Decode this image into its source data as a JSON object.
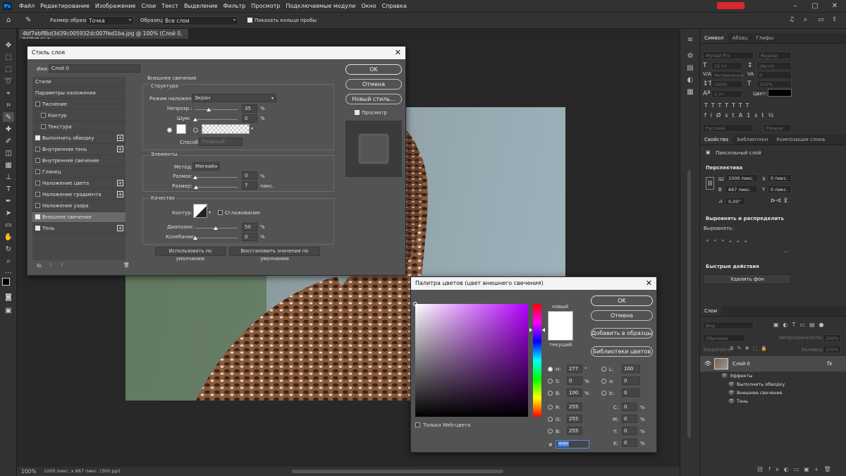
{
  "menu": [
    "Файл",
    "Редактирование",
    "Изображение",
    "Слои",
    "Текст",
    "Выделение",
    "Фильтр",
    "Просмотр",
    "Подключаемые модули",
    "Окно",
    "Справка"
  ],
  "options": {
    "sample_size_label": "Размер образца:",
    "sample_size": "Точка",
    "sample_label": "Образец:",
    "sample": "Все слои",
    "show_ring": "Показать кольцо пробы"
  },
  "document": {
    "tab": "4bf7ebf8bd3d39c005932dc007fed1ba.jpg @ 100% (Слой 0, RGB/8#) *",
    "zoom": "100%",
    "info": "1000 пикс. x 667 пикс. (300 ppi)"
  },
  "right": {
    "tabs_char": [
      "Символ",
      "Абзац",
      "Глифы"
    ],
    "font": "Myriad Pro",
    "style": "Regular",
    "size": "12 пт",
    "leading": "(Авто)",
    "kerning": "Метрически",
    "tracking": "0",
    "vscale": "100%",
    "hscale": "100%",
    "baseline": "0 пт",
    "color_label": "Цвет:",
    "lang": "Русский",
    "aa": "Резкое",
    "tabs_props": [
      "Свойства",
      "Библиотеки",
      "Композиции слоев"
    ],
    "pixel_layer": "Пиксельный слой",
    "perspective": "Перспектива",
    "w_label": "Ш",
    "w": "1000 пикс.",
    "h_label": "В",
    "h": "667 пикс.",
    "x_label": "X",
    "x": "0 пикс.",
    "y_label": "Y",
    "y": "0 пикс.",
    "angle": "0,00°",
    "align_title": "Выровнять и распределить",
    "align_label": "Выровнять:",
    "quick_title": "Быстрые действия",
    "remove_bg": "Удалить фон",
    "layers_tab": "Слои",
    "kind": "Вид",
    "blend": "Обычные",
    "opacity_label": "Непрозрачность:",
    "opacity": "100%",
    "lock_label": "Закрепить:",
    "fill_label": "Заливка:",
    "fill": "100%",
    "layer_name": "Слой 0",
    "effects": "Эффекты",
    "fx1": "Выполнить обводку",
    "fx2": "Внешнее свечение",
    "fx3": "Тень"
  },
  "style_dialog": {
    "title": "Стиль слоя",
    "name_label": "Имя:",
    "name": "Слой 0",
    "items": [
      {
        "label": "Стили",
        "check": null,
        "plus": false,
        "indent": false
      },
      {
        "label": "Параметры наложения",
        "check": null,
        "plus": false,
        "indent": false
      },
      {
        "label": "Тиснение",
        "check": false,
        "plus": false,
        "indent": false
      },
      {
        "label": "Контур",
        "check": false,
        "plus": false,
        "indent": true
      },
      {
        "label": "Текстура",
        "check": false,
        "plus": false,
        "indent": true
      },
      {
        "label": "Выполнить обводку",
        "check": true,
        "plus": true,
        "indent": false
      },
      {
        "label": "Внутренняя тень",
        "check": false,
        "plus": true,
        "indent": false
      },
      {
        "label": "Внутреннее свечение",
        "check": false,
        "plus": false,
        "indent": false
      },
      {
        "label": "Глянец",
        "check": false,
        "plus": false,
        "indent": false
      },
      {
        "label": "Наложение цвета",
        "check": false,
        "plus": true,
        "indent": false
      },
      {
        "label": "Наложение градиента",
        "check": false,
        "plus": true,
        "indent": false
      },
      {
        "label": "Наложение узора",
        "check": false,
        "plus": false,
        "indent": false
      },
      {
        "label": "Внешнее свечение",
        "check": true,
        "plus": false,
        "indent": false
      },
      {
        "label": "Тень",
        "check": true,
        "plus": true,
        "indent": false
      }
    ],
    "section": "Внешнее свечение",
    "structure": "Структура",
    "blend_label": "Режим наложения:",
    "blend": "Экран",
    "opacity_label": "Непрозр.:",
    "opacity": "35",
    "noise_label": "Шум:",
    "noise": "0",
    "pct": "%",
    "method_label": "Способ:",
    "method": "Плавный",
    "elements": "Элементы",
    "tech_label": "Метод:",
    "tech": "Мягкий",
    "spread_label": "Размах:",
    "spread": "0",
    "size_label": "Размер:",
    "size": "7",
    "px": "пикс.",
    "quality": "Качество",
    "contour_label": "Контур:",
    "antialias": "Сглаживание",
    "range_label": "Диапазон:",
    "range": "50",
    "jitter_label": "Колебание:",
    "jitter": "0",
    "default_btn": "Использовать по умолчанию",
    "reset_btn": "Восстановить значения по умолчанию",
    "ok": "OK",
    "cancel": "Отмена",
    "new_style": "Новый стиль...",
    "preview": "Просмотр",
    "fx": "fx."
  },
  "picker": {
    "title": "Палитра цветов (цвет внешнего свечения)",
    "ok": "OK",
    "cancel": "Отмена",
    "add": "Добавить в образцы",
    "libs": "Библиотеки цветов",
    "new": "новый",
    "current": "текущий",
    "web": "Только Web-цвета",
    "h_label": "H:",
    "h": "277",
    "h_u": "°",
    "s_label": "S:",
    "s": "0",
    "s_u": "%",
    "b_label": "B:",
    "b": "100",
    "b_u": "%",
    "r_label": "R:",
    "r": "255",
    "g_label": "G:",
    "g": "255",
    "bb_label": "B:",
    "bb": "255",
    "l_label": "L:",
    "l": "100",
    "a_label": "a:",
    "a": "0",
    "lb_label": "b:",
    "lb": "0",
    "c_label": "C:",
    "c": "0",
    "m_label": "M:",
    "m": "0",
    "y_label": "Y:",
    "y": "0",
    "k_label": "K:",
    "k": "0",
    "pct": "%",
    "hex_label": "#",
    "hex": "ffffff"
  }
}
